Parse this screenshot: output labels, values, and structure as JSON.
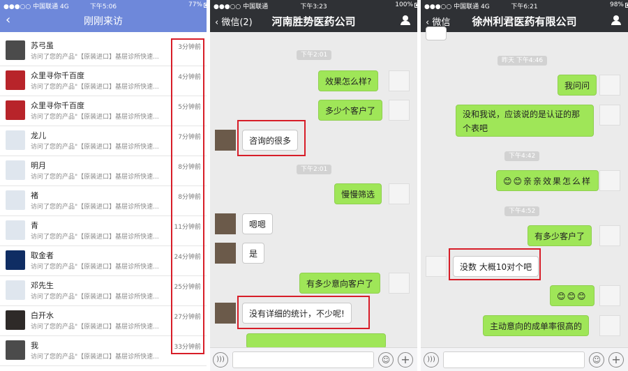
{
  "panel1": {
    "status": {
      "carrier": "●●●○○ 中国联通 4G",
      "time": "下午5:06",
      "battery": "77%"
    },
    "title": "刚刚来访",
    "back_icon": "chevron-left-icon",
    "rows": [
      {
        "name": "苏弓虽",
        "desc": "访问了您的产品\"【原装进口】基层诊所快速...",
        "ago": "3分钟前"
      },
      {
        "name": "众里寻你千百度",
        "desc": "访问了您的产品\"【原装进口】基层诊所快速...",
        "ago": "4分钟前"
      },
      {
        "name": "众里寻你千百度",
        "desc": "访问了您的产品\"【原装进口】基层诊所快速...",
        "ago": "5分钟前"
      },
      {
        "name": "龙儿",
        "desc": "访问了您的产品\"【原装进口】基层诊所快速...",
        "ago": "7分钟前"
      },
      {
        "name": "明月",
        "desc": "访问了您的产品\"【原装进口】基层诊所快速...",
        "ago": "8分钟前"
      },
      {
        "name": "褚",
        "desc": "访问了您的产品\"【原装进口】基层诊所快速...",
        "ago": "8分钟前"
      },
      {
        "name": "青",
        "desc": "访问了您的产品\"【原装进口】基层诊所快速...",
        "ago": "11分钟前"
      },
      {
        "name": "取金者",
        "desc": "访问了您的产品\"【原装进口】基层诊所快速...",
        "ago": "24分钟前"
      },
      {
        "name": "邓先生",
        "desc": "访问了您的产品\"【原装进口】基层诊所快速...",
        "ago": "25分钟前"
      },
      {
        "name": "白开水",
        "desc": "访问了您的产品\"【原装进口】基层诊所快速...",
        "ago": "27分钟前"
      },
      {
        "name": "我",
        "desc": "访问了您的产品\"【原装进口】基层诊所快速...",
        "ago": "33分钟前"
      }
    ]
  },
  "panel2": {
    "status": {
      "carrier": "●●●○○ 中国联通",
      "time": "下午3:23",
      "battery": "100%"
    },
    "back": "‹ 微信(2)",
    "title": "河南胜势医药公司",
    "messages": {
      "ts1": "下午2:01",
      "m1": "效果怎么样?",
      "m2": "多少个客户了",
      "m3": "咨询的很多",
      "ts2": "下午2:01",
      "m4": "慢慢筛选",
      "m5": "嗯嗯",
      "m6": "是",
      "m7": "有多少意向客户了",
      "m8": "没有详细的统计，不少呢!"
    }
  },
  "panel3": {
    "status": {
      "carrier": "●●●○○ 中国联通 4G",
      "time": "下午6:21",
      "battery": "98%"
    },
    "back": "‹ 微信",
    "title": "徐州利君医药有限公司",
    "messages": {
      "ts1": "昨天 下午4:46",
      "m1": "我问问",
      "m2": "没和我说，应该说的是认证的那个表吧",
      "ts2": "下午4:42",
      "m3": "😊😊亲亲效果怎么样",
      "ts3": "下午4:52",
      "m4": "有多少客户了",
      "m5": "没数 大概10对个吧",
      "m6": "😊😊😊",
      "m7": "主动意向的成单率很高的"
    }
  },
  "colors": {
    "nav_blue": "#6e88da",
    "nav_dark": "#2f3135",
    "bubble_green": "#9fe658",
    "highlight_red": "#d71d28"
  }
}
